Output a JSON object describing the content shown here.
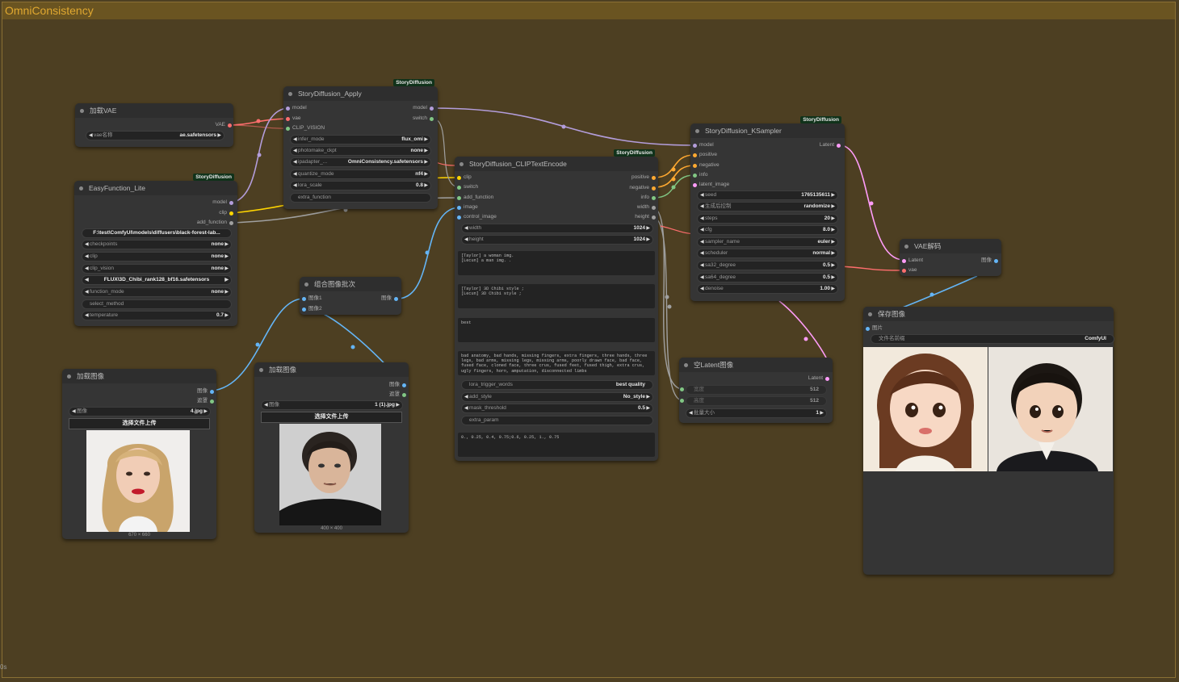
{
  "group": {
    "title": "OmniConsistency"
  },
  "corner_label": "0s",
  "colors": {
    "model": "#b39ddb",
    "vae": "#ff6e6e",
    "clip": "#ffd500",
    "image": "#64b5f6",
    "latent": "#ff9cf9",
    "conditioning": "#ffa931",
    "mask": "#81c784",
    "generic": "#a0a0a0"
  },
  "nodes": {
    "vae_loader": {
      "title": "加载VAE",
      "out_vae": "VAE",
      "w_vae_name_label": "vae名称",
      "w_vae_name_value": "ae.safetensors"
    },
    "easy": {
      "title": "EasyFunction_Lite",
      "badge": "StoryDiffusion",
      "out_model": "model",
      "out_clip": "clip",
      "out_add": "add_function",
      "path": "F:\\test\\ComfyUI\\models\\diffusers\\black-forest-lab...",
      "w_ckpt_label": "checkpoints",
      "w_ckpt_value": "none",
      "w_clip_label": "clip",
      "w_clip_value": "none",
      "w_clipv_label": "clip_vision",
      "w_clipv_value": "none",
      "w_lora_value": "FLUX\\3D_Chibi_rank128_bf16.safetensors",
      "w_func_label": "function_mode",
      "w_func_value": "none",
      "w_select_label": "select_method",
      "w_temp_label": "temperature",
      "w_temp_value": "0.7"
    },
    "apply": {
      "title": "StoryDiffusion_Apply",
      "badge": "StoryDiffusion",
      "in_model": "model",
      "in_vae": "vae",
      "in_clipv": "CLIP_VISION",
      "out_model": "model",
      "out_switch": "switch",
      "w_infer_label": "infer_mode",
      "w_infer_value": "flux_omi",
      "w_photo_label": "photomake_ckpt",
      "w_photo_value": "none",
      "w_ipa_label": "ipadapter_...",
      "w_ipa_value": "OmniConsistency.safetensors",
      "w_quant_label": "quantize_mode",
      "w_quant_value": "nf4",
      "w_lora_label": "lora_scale",
      "w_lora_value": "0.8",
      "w_extra_label": "extra_function"
    },
    "encode": {
      "title": "StoryDiffusion_CLIPTextEncode",
      "badge": "StoryDiffusion",
      "in_clip": "clip",
      "in_switch": "switch",
      "in_add": "add_function",
      "in_image": "image",
      "in_control": "control_image",
      "out_pos": "positive",
      "out_neg": "negative",
      "out_info": "info",
      "out_width": "width",
      "out_height": "height",
      "w_width_label": "width",
      "w_width_value": "1024",
      "w_height_label": "height",
      "w_height_value": "1024",
      "text_char": "[Taylor] a woman img.\n[Lecun] a man img. .",
      "text_scene": "[Taylor] 3D Chibi style ;\n[Lecun] 3D Chibi style ;",
      "text_pos": "best",
      "text_neg": "bad anatomy, bad hands, missing fingers, extra fingers, three hands, three legs, bad arms, missing legs, missing arms, poorly drawn face, bad face, fused face, cloned face, three crus, fused feet, fused thigh, extra crus, ugly fingers, horn, amputation, disconnected limbs",
      "w_trigger_label": "lora_trigger_words",
      "w_trigger_value": "best quality",
      "w_style_label": "add_style",
      "w_style_value": "No_style",
      "w_mask_label": "mask_threshold",
      "w_mask_value": "0.5",
      "w_extra_label": "extra_param",
      "text_sched": "0., 0.25, 0.4, 0.75;0.6, 0.25, 1., 0.75"
    },
    "ksampler": {
      "title": "StoryDiffusion_KSampler",
      "badge": "StoryDiffusion",
      "in_model": "model",
      "in_pos": "positive",
      "in_neg": "negative",
      "in_info": "info",
      "in_latent": "latent_image",
      "out_latent": "Latent",
      "w_seed_label": "seed",
      "w_seed_value": "1765135611",
      "w_ctrl_label": "生成后控制",
      "w_ctrl_value": "randomize",
      "w_steps_label": "steps",
      "w_steps_value": "20",
      "w_cfg_label": "cfg",
      "w_cfg_value": "8.0",
      "w_sampler_label": "sampler_name",
      "w_sampler_value": "euler",
      "w_sched_label": "scheduler",
      "w_sched_value": "normal",
      "w_sa32_label": "sa32_degree",
      "w_sa32_value": "0.5",
      "w_sa64_label": "sa64_degree",
      "w_sa64_value": "0.5",
      "w_denoise_label": "denoise",
      "w_denoise_value": "1.00"
    },
    "vae_decode": {
      "title": "VAE解码",
      "in_latent": "Latent",
      "in_vae": "vae",
      "out_image": "图像"
    },
    "save": {
      "title": "保存图像",
      "in_images": "图片",
      "w_prefix_label": "文件名前缀",
      "w_prefix_value": "ComfyUI"
    },
    "latent": {
      "title": "空Latent图像",
      "out_latent": "Latent",
      "w_width_label": "宽度",
      "w_width_value": "512",
      "w_height_label": "高度",
      "w_height_value": "512",
      "w_batch_label": "批量大小",
      "w_batch_value": "1"
    },
    "batch": {
      "title": "组合图像批次",
      "in_image1": "图像1",
      "in_image2": "图像2",
      "out_image": "图像"
    },
    "load1": {
      "title": "加载图像",
      "out_image": "图像",
      "out_mask": "遮罩",
      "w_image_label": "图像",
      "w_image_value": "4.jpg",
      "upload": "选择文件上传",
      "size": "670 × 660"
    },
    "load2": {
      "title": "加载图像",
      "out_image": "图像",
      "out_mask": "遮罩",
      "w_image_label": "图像",
      "w_image_value": "1 (1).jpg",
      "upload": "选择文件上传",
      "size": "400 × 400"
    }
  }
}
